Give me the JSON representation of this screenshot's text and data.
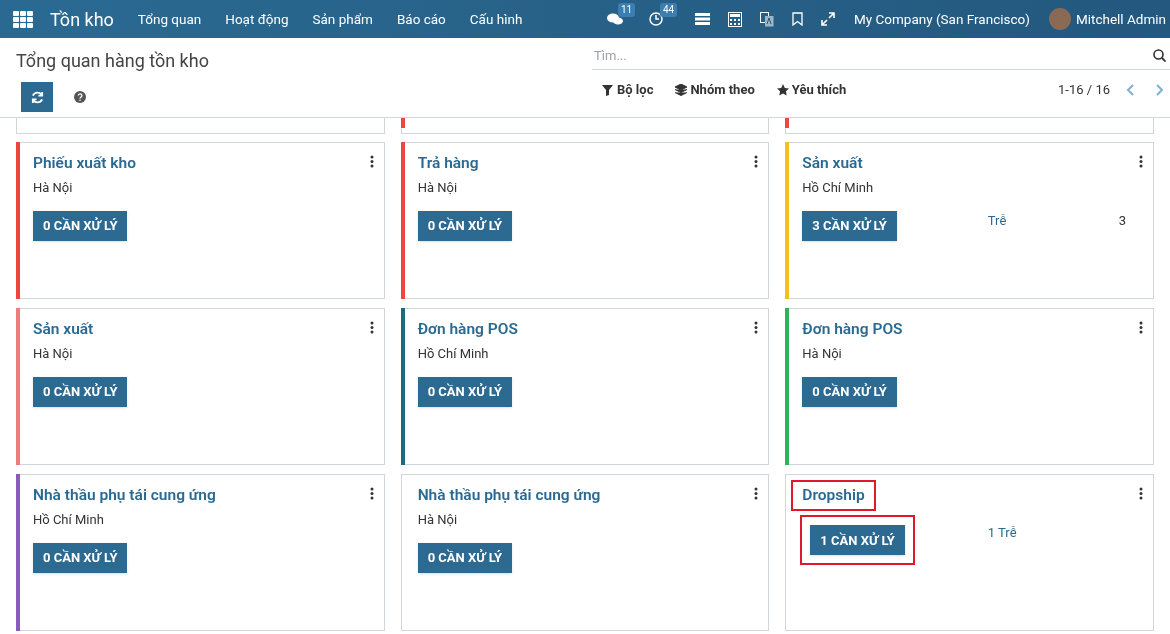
{
  "navbar": {
    "app_title": "Tồn kho",
    "menu": [
      "Tổng quan",
      "Hoạt động",
      "Sản phẩm",
      "Báo cáo",
      "Cấu hình"
    ],
    "messages_badge": "11",
    "activities_badge": "44",
    "company": "My Company (San Francisco)",
    "user": "Mitchell Admin"
  },
  "control_panel": {
    "title": "Tổng quan hàng tồn kho",
    "search": {
      "placeholder": "Tìm..."
    },
    "filters": [
      "Bộ lọc",
      "Nhóm theo",
      "Yêu thích"
    ],
    "pager": "1-16 / 16"
  },
  "cut_cards": [
    {
      "kind": "plain"
    },
    {
      "kind": "striped",
      "color": "#f0453a"
    },
    {
      "kind": "striped",
      "color": "#f0453a"
    }
  ],
  "cards": [
    {
      "title": "Phiếu xuất kho",
      "warehouse": "Hà Nội",
      "button": "0 CẦN XỬ LÝ",
      "color": "#f0453a",
      "highlighted": false
    },
    {
      "title": "Trả hàng",
      "warehouse": "Hà Nội",
      "button": "0 CẦN XỬ LÝ",
      "color": "#f0453a",
      "highlighted": false
    },
    {
      "title": "Sản xuất",
      "warehouse": "Hồ Chí Minh",
      "button": "3 CẦN XỬ LÝ",
      "color": "#f4c01a",
      "late_label": "Trễ",
      "late_count": "3",
      "highlighted": false
    },
    {
      "title": "Sản xuất",
      "warehouse": "Hà Nội",
      "button": "0 CẦN XỬ LÝ",
      "color": "#ec7e7e",
      "highlighted": false
    },
    {
      "title": "Đơn hàng POS",
      "warehouse": "Hồ Chí Minh",
      "button": "0 CẦN XỬ LÝ",
      "color": "#1f6a7c",
      "highlighted": false
    },
    {
      "title": "Đơn hàng POS",
      "warehouse": "Hà Nội",
      "button": "0 CẦN XỬ LÝ",
      "color": "#2fb458",
      "highlighted": false
    },
    {
      "title": "Nhà thầu phụ tái cung ứng",
      "warehouse": "Hồ Chí Minh",
      "button": "0 CẦN XỬ LÝ",
      "color": "#8a5bbf",
      "highlighted": false
    },
    {
      "title": "Nhà thầu phụ tái cung ứng",
      "warehouse": "Hà Nội",
      "button": "0 CẦN XỬ LÝ",
      "highlighted": false
    },
    {
      "title": "Dropship",
      "button": "1 CẦN XỬ LÝ",
      "late_label": "1 Trễ",
      "highlighted": true
    }
  ]
}
